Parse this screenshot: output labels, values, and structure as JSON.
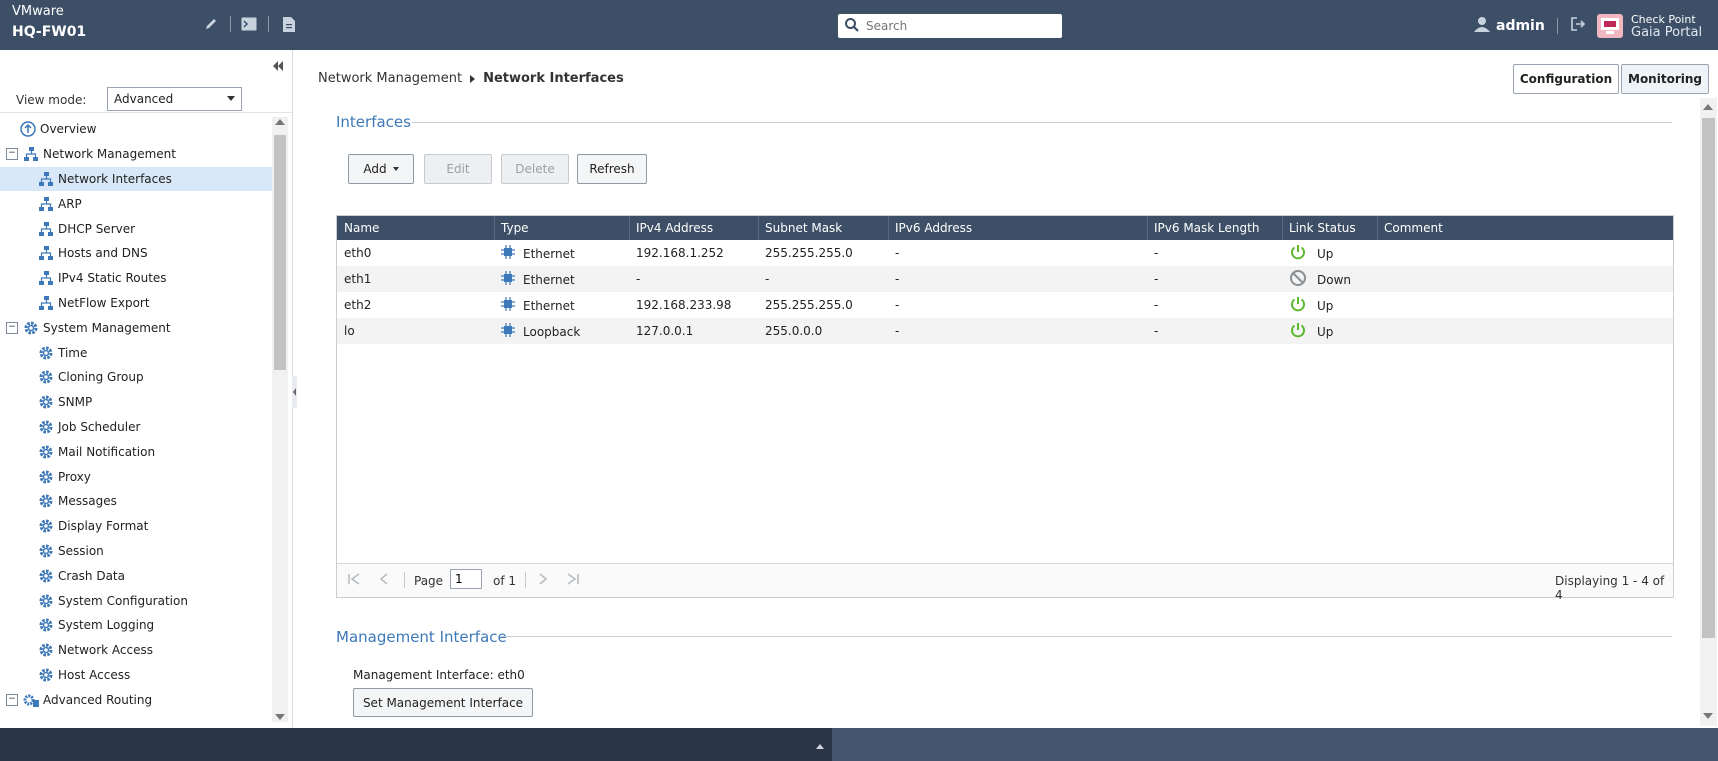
{
  "header": {
    "vendor": "VMware",
    "hostname": "HQ-FW01",
    "search_placeholder": "Search",
    "user": "admin",
    "logo_line1": "Check Point",
    "logo_line2": "Gaia Portal",
    "icons": [
      "pencil-icon",
      "terminal-icon",
      "document-icon",
      "search-icon",
      "user-icon",
      "logout-icon",
      "gaia-logo-icon"
    ]
  },
  "sidebar": {
    "view_mode_label": "View mode:",
    "view_mode_value": "Advanced",
    "items": [
      {
        "label": "Overview",
        "level": 0,
        "icon": "overview-icon"
      },
      {
        "label": "Network Management",
        "level": 0,
        "icon": "network-icon",
        "expandable": true
      },
      {
        "label": "Network Interfaces",
        "level": 1,
        "icon": "network-icon",
        "selected": true
      },
      {
        "label": "ARP",
        "level": 1,
        "icon": "network-icon"
      },
      {
        "label": "DHCP Server",
        "level": 1,
        "icon": "network-icon"
      },
      {
        "label": "Hosts and DNS",
        "level": 1,
        "icon": "network-icon"
      },
      {
        "label": "IPv4 Static Routes",
        "level": 1,
        "icon": "network-icon"
      },
      {
        "label": "NetFlow Export",
        "level": 1,
        "icon": "network-icon"
      },
      {
        "label": "System Management",
        "level": 0,
        "icon": "gear-icon",
        "expandable": true
      },
      {
        "label": "Time",
        "level": 1,
        "icon": "gear-icon"
      },
      {
        "label": "Cloning Group",
        "level": 1,
        "icon": "gear-icon"
      },
      {
        "label": "SNMP",
        "level": 1,
        "icon": "gear-icon"
      },
      {
        "label": "Job Scheduler",
        "level": 1,
        "icon": "gear-icon"
      },
      {
        "label": "Mail Notification",
        "level": 1,
        "icon": "gear-icon"
      },
      {
        "label": "Proxy",
        "level": 1,
        "icon": "gear-icon"
      },
      {
        "label": "Messages",
        "level": 1,
        "icon": "gear-icon"
      },
      {
        "label": "Display Format",
        "level": 1,
        "icon": "gear-icon"
      },
      {
        "label": "Session",
        "level": 1,
        "icon": "gear-icon"
      },
      {
        "label": "Crash Data",
        "level": 1,
        "icon": "gear-icon"
      },
      {
        "label": "System Configuration",
        "level": 1,
        "icon": "gear-icon"
      },
      {
        "label": "System Logging",
        "level": 1,
        "icon": "gear-icon"
      },
      {
        "label": "Network Access",
        "level": 1,
        "icon": "gear-icon"
      },
      {
        "label": "Host Access",
        "level": 1,
        "icon": "gear-icon"
      },
      {
        "label": "Advanced Routing",
        "level": 0,
        "icon": "routing-icon",
        "expandable": true
      }
    ]
  },
  "breadcrumb": {
    "parent": "Network Management",
    "current": "Network Interfaces"
  },
  "mode_buttons": {
    "configuration": "Configuration",
    "monitoring": "Monitoring"
  },
  "interfaces": {
    "section_title": "Interfaces",
    "actions": {
      "add": "Add",
      "edit": "Edit",
      "delete": "Delete",
      "refresh": "Refresh"
    },
    "columns": [
      "Name",
      "Type",
      "IPv4 Address",
      "Subnet Mask",
      "IPv6 Address",
      "IPv6 Mask Length",
      "Link Status",
      "Comment"
    ],
    "rows": [
      {
        "name": "eth0",
        "type": "Ethernet",
        "ipv4": "192.168.1.252",
        "mask": "255.255.255.0",
        "ipv6": "-",
        "ipv6_len": "-",
        "status": "Up",
        "comment": ""
      },
      {
        "name": "eth1",
        "type": "Ethernet",
        "ipv4": "-",
        "mask": "-",
        "ipv6": "-",
        "ipv6_len": "-",
        "status": "Down",
        "comment": ""
      },
      {
        "name": "eth2",
        "type": "Ethernet",
        "ipv4": "192.168.233.98",
        "mask": "255.255.255.0",
        "ipv6": "-",
        "ipv6_len": "-",
        "status": "Up",
        "comment": ""
      },
      {
        "name": "lo",
        "type": "Loopback",
        "ipv4": "127.0.0.1",
        "mask": "255.0.0.0",
        "ipv6": "-",
        "ipv6_len": "-",
        "status": "Up",
        "comment": ""
      }
    ],
    "pager": {
      "page_label": "Page",
      "page_value": "1",
      "of_label": "of 1",
      "displaying": "Displaying 1 - 4 of 4"
    }
  },
  "management": {
    "section_title": "Management Interface",
    "label": "Management Interface: eth0",
    "button": "Set Management Interface"
  },
  "colors": {
    "header_bg": "#3d4f66",
    "accent_blue": "#3d79b8",
    "status_up": "#5cb82e",
    "status_down": "#8a8f95"
  }
}
